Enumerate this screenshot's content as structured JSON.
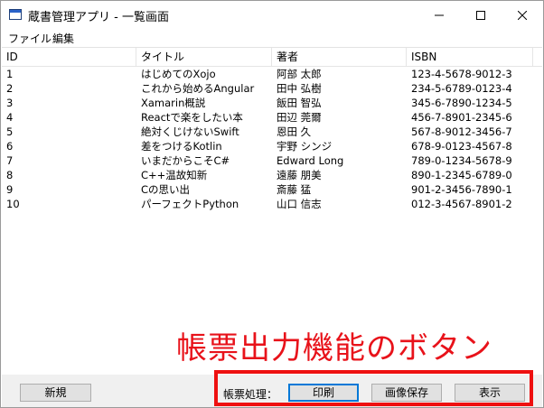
{
  "window": {
    "title": "蔵書管理アプリ - 一覧画面"
  },
  "menu": {
    "file": "ファイル",
    "edit": "編集"
  },
  "list": {
    "headers": [
      "ID",
      "タイトル",
      "著者",
      "ISBN"
    ],
    "rows": [
      [
        "1",
        "はじめてのXojo",
        "阿部 太郎",
        "123-4-5678-9012-3"
      ],
      [
        "2",
        "これから始めるAngular",
        "田中 弘樹",
        "234-5-6789-0123-4"
      ],
      [
        "3",
        "Xamarin概説",
        "飯田 智弘",
        "345-6-7890-1234-5"
      ],
      [
        "4",
        "Reactで楽をしたい本",
        "田辺 莞爾",
        "456-7-8901-2345-6"
      ],
      [
        "5",
        "絶対くじけないSwift",
        "恩田 久",
        "567-8-9012-3456-7"
      ],
      [
        "6",
        "差をつけるKotlin",
        "宇野 シンジ",
        "678-9-0123-4567-8"
      ],
      [
        "7",
        "いまだからこそC#",
        "Edward Long",
        "789-0-1234-5678-9"
      ],
      [
        "8",
        "C++温故知新",
        "遠藤 朋美",
        "890-1-2345-6789-0"
      ],
      [
        "9",
        "Cの思い出",
        "斎藤 猛",
        "901-2-3456-7890-1"
      ],
      [
        "10",
        "パーフェクトPython",
        "山口 信志",
        "012-3-4567-8901-2"
      ]
    ]
  },
  "annotation": {
    "text": "帳票出力機能のボタン",
    "color": "#e8121a"
  },
  "footer": {
    "new_label": "新規",
    "process_label": "帳票処理：",
    "print_label": "印刷",
    "save_image_label": "画像保存",
    "show_label": "表示"
  },
  "icons": {
    "app": "window-icon",
    "minimize": "minimize-icon",
    "maximize": "maximize-icon",
    "close": "close-icon"
  }
}
